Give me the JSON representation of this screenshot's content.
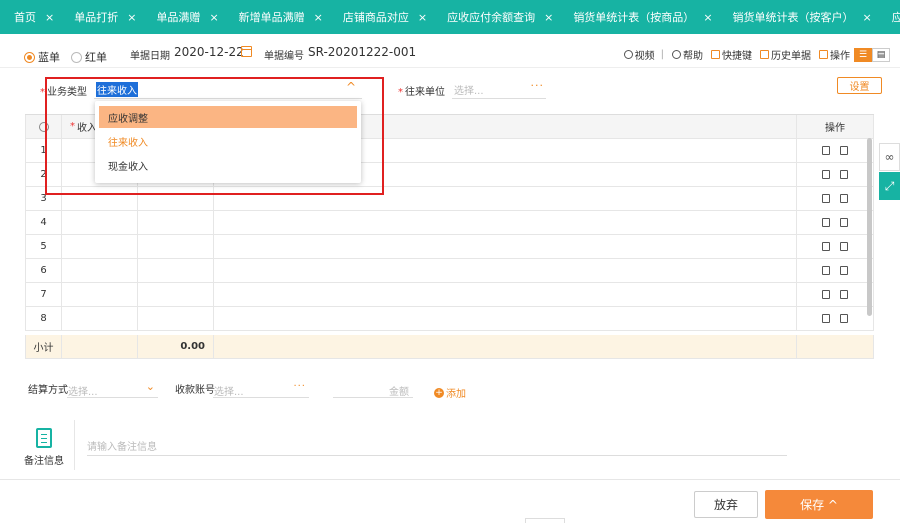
{
  "tabs": [
    {
      "label": "首页"
    },
    {
      "label": "单品打折"
    },
    {
      "label": "单品满赠"
    },
    {
      "label": "新增单品满赠"
    },
    {
      "label": "店铺商品对应"
    },
    {
      "label": "应收应付余额查询"
    },
    {
      "label": "销货单统计表（按商品）"
    },
    {
      "label": "销货单统计表（按客户）"
    },
    {
      "label": "应收"
    }
  ],
  "tab_close": "×",
  "header": {
    "radio_blue": "蓝单",
    "radio_red": "红单",
    "date_label": "单据日期",
    "date_value": "2020-12-22",
    "docno_label": "单据编号",
    "docno_value": "SR-20201222-001",
    "tools": {
      "video": "视频",
      "help": "帮助",
      "shortcut": "快捷键",
      "history": "历史单据",
      "ops": "操作"
    }
  },
  "form": {
    "biz_type_label": "业务类型",
    "biz_type_value": "往来收入",
    "unit_label": "往来单位",
    "unit_placeholder": "选择...",
    "unit_dots": "···",
    "settings_label": "设置",
    "required_mark": "*",
    "chevron_up": "^"
  },
  "dropdown": {
    "options": [
      "应收调整",
      "往来收入",
      "现金收入"
    ],
    "highlighted": "应收调整",
    "selected": "往来收入"
  },
  "grid": {
    "col_income_label": "收入",
    "col_ops_label": "操作",
    "rows": [
      "1",
      "2",
      "3",
      "4",
      "5",
      "6",
      "7",
      "8"
    ],
    "subtotal_label": "小计",
    "subtotal_amount": "0.00"
  },
  "settlement": {
    "method_label": "结算方式",
    "method_placeholder": "选择...",
    "account_label": "收款账号",
    "account_placeholder": "选择...",
    "account_dots": "···",
    "amount_placeholder": "金额",
    "add_label": "添加",
    "add_icon": "+"
  },
  "notes": {
    "label": "备注信息",
    "placeholder": "请输入备注信息"
  },
  "footer": {
    "discard": "放弃",
    "save": "保存 ^"
  },
  "colors": {
    "accent": "#f08a24",
    "teal": "#17b3a3",
    "highlight_box": "#e02020"
  }
}
